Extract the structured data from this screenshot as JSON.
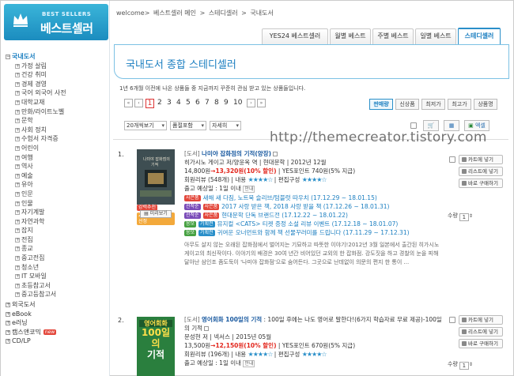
{
  "logo": {
    "small": "BEST SELLERS",
    "big": "베스트셀러"
  },
  "sidebar": {
    "main_title": "국내도서",
    "sub_items": [
      "가정 살림",
      "건강 취미",
      "경제 경영",
      "국어 외국어 사전",
      "대학교재",
      "만화/라이트노벨",
      "문학",
      "사회 정치",
      "수험서 자격증",
      "어린이",
      "여행",
      "역사",
      "예술",
      "유아",
      "인문",
      "인물",
      "자기계발",
      "자연과학",
      "잡지",
      "전집",
      "종교",
      "중고전집",
      "청소년",
      "IT 모바일",
      "초등참고서",
      "중고등참고서"
    ],
    "other_items": [
      {
        "label": "외국도서",
        "new": ""
      },
      {
        "label": "eBook",
        "new": ""
      },
      {
        "label": "e러닝",
        "new": ""
      },
      {
        "label": "캠스앤코믹",
        "new": "new"
      },
      {
        "label": "CD/LP",
        "new": ""
      }
    ]
  },
  "breadcrumb": [
    "welcome>",
    "베스트셀러 메인",
    ">",
    "스테디셀러",
    ">",
    "국내도서"
  ],
  "tabs": [
    "YES24 베스트셀러",
    "월별 베스트",
    "주별 베스트",
    "일별 베스트",
    "스테디셀러"
  ],
  "active_tab": "스테디셀러",
  "panel_title": "국내도서 종합 스테디셀러",
  "description": "1년 6개월 이전에 나온 상품들 중 지금까지 꾸준히 관심 받고 있는 상품들입니다.",
  "pager": {
    "first": "«",
    "prev": "‹",
    "pages": [
      "1",
      "2",
      "3",
      "4",
      "5",
      "6",
      "7",
      "8",
      "9",
      "10"
    ],
    "current": "1",
    "next": "›",
    "last": "»"
  },
  "sort_options": [
    "판매량",
    "신상품",
    "최저가",
    "최고가",
    "상품명"
  ],
  "selects": {
    "per_page": "20개씩보기",
    "filter": "품절포함",
    "view": "자세히"
  },
  "tools": {
    "cart_icon": "cart-icon",
    "wish_icon": "wishlist-icon",
    "excel_label": "엑셀"
  },
  "watermark": "http://themecreator.tistory.com",
  "items": [
    {
      "rank": "1.",
      "tag": "[도서]",
      "title": "나미야 잡화점의 기적",
      "edition": "(양장)",
      "author_line": "히가시노 게이고 저/양윤옥 역 | 현대문학 | 2012년 12월",
      "price": "14,800원",
      "sale": "→13,320원(10% 할인)",
      "point": "| YES포인트 740원(5% 지급)",
      "review": "회원리뷰 (548개) | 내용",
      "stars1": "★★★★☆",
      "edit": "| 편집구성",
      "stars2": "★★★★☆",
      "ship": "출고 예상일 : 1일 이내",
      "ship_badge": "안내",
      "cover_badges": [
        "강력추천",
        "2013 올해의 책 선정"
      ],
      "preview": "미리보기",
      "events": [
        {
          "badges": [
            "사은품"
          ],
          "text": "새해 새 다짐, 노트북 슬리브/텀블럿 따우치 (17.12.29 ~ 18.01.15)"
        },
        {
          "badges": [
            "선착순",
            "사은품"
          ],
          "text": "2017 사랑 받은 책, 2018 사랑 받을 책 (17.12.26 ~ 18.01.31)"
        },
        {
          "badges": [
            "선착순",
            "사은품"
          ],
          "text": "현대문학 단독 브랜드전 (17.12.22 ~ 18.01.22)"
        },
        {
          "badges": [
            "응모",
            "기획전"
          ],
          "text": "뮤지컬 <CATS> 티켓 증정 소설 리뷰 이벤트 (17.12.18 ~ 18.01.07)"
        },
        {
          "badges": [
            "응모",
            "기획전"
          ],
          "text": "귀여운 오너먼트와 함께 책 선물꾸러미를 드립니다 (17.11.29 ~ 17.12.31)"
        }
      ],
      "desc": "아무도 살지 않는 오래된 잡화점에서 벌어지는 기묘하고 따뜻한 이야기!2012년 3월 일본에서 출간된 히가시노 게이고의 최신작이다. 이야기의 배경은 30여 년간 비어있던 교외의 한 잡화점. 강도짓을 하고 경찰의 눈을 피해 달아난 삼인조 좀도둑이 '나미야 잡화점'으로 숨어든다. 그곳으로 난데없이 의문의 편지 한 통이 ...",
      "actions": [
        "카트에 넣기",
        "리스트에 넣기",
        "바로 구매하기"
      ],
      "qty_label": "수량",
      "qty": "1"
    },
    {
      "rank": "2.",
      "tag": "[도서]",
      "title": "영어회화 100일의 기적",
      "edition": "",
      "subtitle": ": 100일 후에는 나도 영어로 말한다!(6가지 학습자료 무료 제공)-100일의 기적",
      "author_line": "문성현 저 | 넥서스 | 2015년 05월",
      "price": "13,500원",
      "sale": "→12,150원(10% 할인)",
      "point": "| YES포인트 670원(5% 지급)",
      "review": "회원리뷰 (196개) | 내용",
      "stars1": "★★★★☆",
      "edit": "| 편집구성",
      "stars2": "★★★★☆",
      "ship": "출고 예상일 : 1일 이내",
      "ship_badge": "안내",
      "cover_text": [
        "영어회화",
        "100일의",
        "기적"
      ],
      "actions": [
        "카트에 넣기",
        "리스트에 넣기",
        "바로 구매하기"
      ],
      "qty_label": "수량",
      "qty": "1"
    }
  ]
}
